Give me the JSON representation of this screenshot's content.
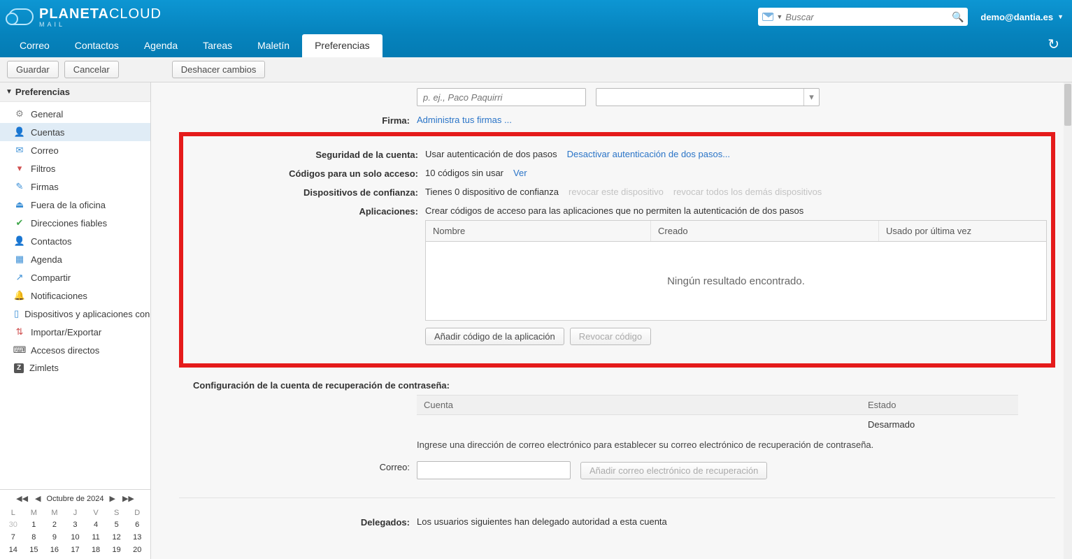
{
  "header": {
    "brand_strong": "PLANETA",
    "brand_light": "CLOUD",
    "brand_sub": "MAIL",
    "search_placeholder": "Buscar",
    "user": "demo@dantia.es"
  },
  "nav": {
    "tabs": [
      "Correo",
      "Contactos",
      "Agenda",
      "Tareas",
      "Maletín",
      "Preferencias"
    ],
    "active_index": 5
  },
  "toolbar": {
    "save": "Guardar",
    "cancel": "Cancelar",
    "undo": "Deshacer cambios"
  },
  "sidebar": {
    "head": "Preferencias",
    "items": [
      {
        "label": "General",
        "icon": "gear"
      },
      {
        "label": "Cuentas",
        "icon": "person",
        "selected": true
      },
      {
        "label": "Correo",
        "icon": "mail"
      },
      {
        "label": "Filtros",
        "icon": "filter"
      },
      {
        "label": "Firmas",
        "icon": "sign"
      },
      {
        "label": "Fuera de la oficina",
        "icon": "away"
      },
      {
        "label": "Direcciones fiables",
        "icon": "shield"
      },
      {
        "label": "Contactos",
        "icon": "cont"
      },
      {
        "label": "Agenda",
        "icon": "cal"
      },
      {
        "label": "Compartir",
        "icon": "share"
      },
      {
        "label": "Notificaciones",
        "icon": "bell"
      },
      {
        "label": "Dispositivos y aplicaciones conectadas",
        "icon": "dev"
      },
      {
        "label": "Importar/Exportar",
        "icon": "imp"
      },
      {
        "label": "Accesos directos",
        "icon": "key"
      },
      {
        "label": "Zimlets",
        "icon": "z"
      }
    ]
  },
  "calendar": {
    "title": "Octubre de 2024",
    "dows": [
      "L",
      "M",
      "M",
      "J",
      "V",
      "S",
      "D"
    ],
    "weeks": [
      [
        {
          "n": "30",
          "dim": true
        },
        {
          "n": "1"
        },
        {
          "n": "2"
        },
        {
          "n": "3"
        },
        {
          "n": "4"
        },
        {
          "n": "5"
        },
        {
          "n": "6"
        }
      ],
      [
        {
          "n": "7"
        },
        {
          "n": "8"
        },
        {
          "n": "9"
        },
        {
          "n": "10"
        },
        {
          "n": "11"
        },
        {
          "n": "12"
        },
        {
          "n": "13"
        }
      ],
      [
        {
          "n": "14"
        },
        {
          "n": "15"
        },
        {
          "n": "16"
        },
        {
          "n": "17"
        },
        {
          "n": "18"
        },
        {
          "n": "19"
        },
        {
          "n": "20"
        }
      ]
    ]
  },
  "form": {
    "name_placeholder": "p. ej., Paco Paquirri",
    "signature_label": "Firma:",
    "signature_link": "Administra tus firmas ...",
    "security_label": "Seguridad de la cuenta:",
    "security_text": "Usar autenticación de dos pasos",
    "security_link": "Desactivar autenticación de dos pasos...",
    "otc_label": "Códigos para un solo acceso:",
    "otc_text": "10 códigos sin usar",
    "otc_link": "Ver",
    "trusted_label": "Dispositivos de confianza:",
    "trusted_text": "Tienes 0 dispositivo de confianza",
    "trusted_revoke_this": "revocar este dispositivo",
    "trusted_revoke_all": "revocar todos los demás dispositivos",
    "apps_label": "Aplicaciones:",
    "apps_text": "Crear códigos de acceso para las aplicaciones que no permiten la autenticación de dos pasos",
    "apps_cols": {
      "name": "Nombre",
      "created": "Creado",
      "last": "Usado por última vez"
    },
    "apps_empty": "Ningún resultado encontrado.",
    "apps_add": "Añadir código de la aplicación",
    "apps_revoke": "Revocar código",
    "recovery_head": "Configuración de la cuenta de recuperación de contraseña:",
    "recovery_cols": {
      "account": "Cuenta",
      "state": "Estado"
    },
    "recovery_state_val": "Desarmado",
    "recovery_hint": "Ingrese una dirección de correo electrónico para establecer su correo electrónico de recuperación de contraseña.",
    "recovery_email_label": "Correo:",
    "recovery_add_btn": "Añadir correo electrónico de recuperación",
    "delegates_label": "Delegados:",
    "delegates_text": "Los usuarios siguientes han delegado autoridad a esta cuenta"
  }
}
